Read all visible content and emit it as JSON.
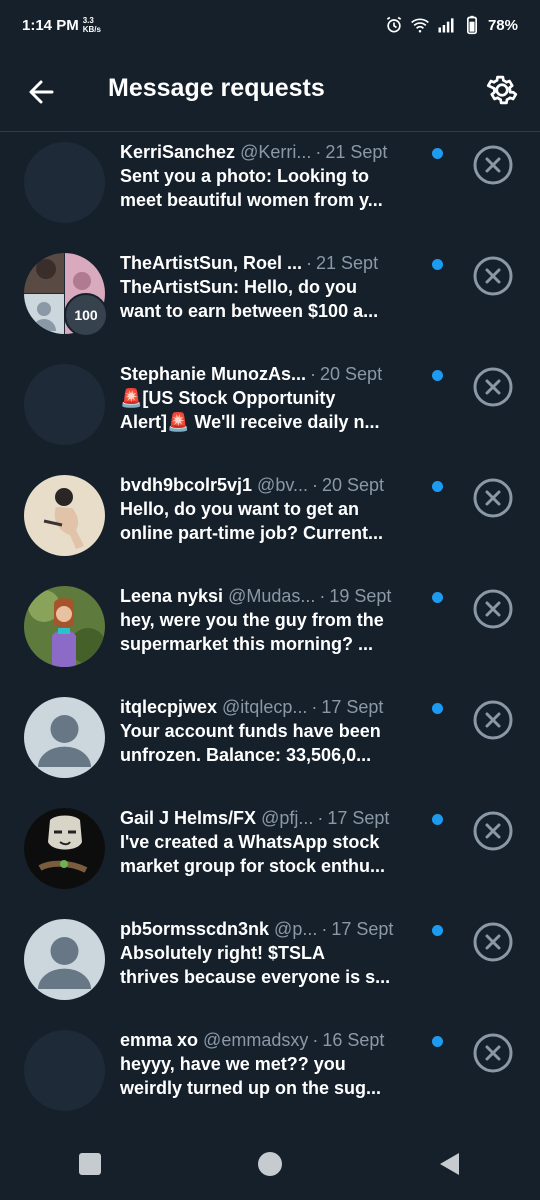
{
  "status_bar": {
    "time": "1:14 PM",
    "speed_value": "3.3",
    "speed_unit": "KB/s",
    "battery": "78%",
    "icons": [
      "alarm-icon",
      "wifi-icon",
      "signal-icon",
      "battery-icon"
    ]
  },
  "header": {
    "title": "Message requests",
    "back_icon": "arrow-left-icon",
    "settings_icon": "gear-icon"
  },
  "colors": {
    "background": "#15202b",
    "accent_unread": "#1d9bf0",
    "secondary_text": "#8b98a5"
  },
  "requests": [
    {
      "name": "KerriSanchez",
      "handle": "@Kerri...",
      "date": "21 Sept",
      "preview1": "Sent you a photo: Looking to",
      "preview2": "meet beautiful women from y...",
      "avatar": "blank"
    },
    {
      "name": "TheArtistSun, Roel ...",
      "handle": "",
      "date": "21 Sept",
      "preview1": "TheArtistSun: Hello, do you",
      "preview2": "want to earn between $100 a...",
      "avatar": "group",
      "badge": "100"
    },
    {
      "name": "Stephanie MunozAs...",
      "handle": "",
      "date": "20 Sept",
      "preview1": "🚨[US Stock Opportunity",
      "preview2": "Alert]🚨 We'll receive daily n...",
      "avatar": "blank"
    },
    {
      "name": "bvdh9bcolr5vj1",
      "handle": "@bv...",
      "date": "20 Sept",
      "preview1": "Hello, do you want to get an",
      "preview2": "online part-time job? Current...",
      "avatar": "photo"
    },
    {
      "name": "Leena nyksi",
      "handle": "@Mudas...",
      "date": "19 Sept",
      "preview1": "hey, were you the guy from the",
      "preview2": "supermarket this morning? ...",
      "avatar": "photo"
    },
    {
      "name": "itqlecpjwex",
      "handle": "@itqlecp...",
      "date": "17 Sept",
      "preview1": "Your account funds have been",
      "preview2": "unfrozen. Balance: 33,506,0...",
      "avatar": "default"
    },
    {
      "name": "Gail J Helms/FX",
      "handle": "@pfj...",
      "date": "17 Sept",
      "preview1": "I've created a WhatsApp stock",
      "preview2": "market group for stock enthu...",
      "avatar": "photo"
    },
    {
      "name": "pb5ormsscdn3nk",
      "handle": "@p...",
      "date": "17 Sept",
      "preview1": "Absolutely right! $TSLA",
      "preview2": "thrives because everyone is s...",
      "avatar": "default"
    },
    {
      "name": "emma xo",
      "handle": "@emmadsxy",
      "date": "16 Sept",
      "preview1": "heyyy, have we met?? you",
      "preview2": "weirdly turned up on the sug...",
      "avatar": "blank"
    }
  ],
  "nav": {
    "icons": [
      "recents-square-icon",
      "home-circle-icon",
      "back-triangle-icon"
    ]
  }
}
